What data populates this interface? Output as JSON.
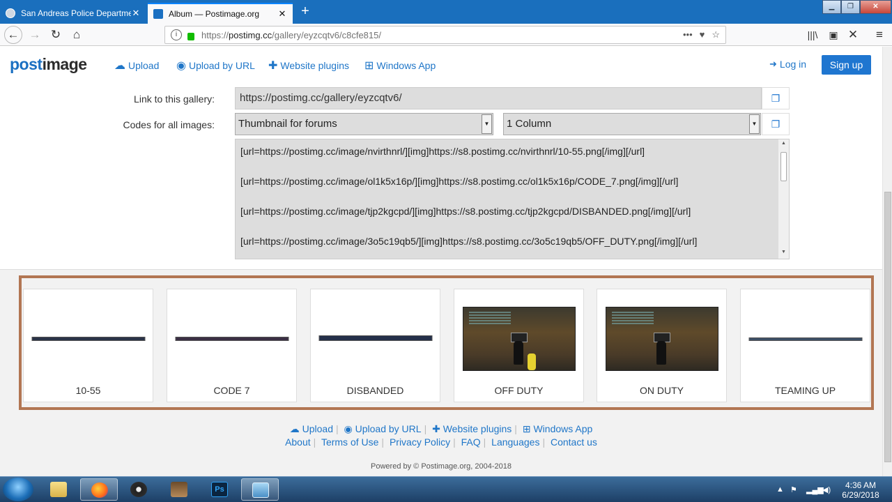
{
  "browser": {
    "tabs": [
      {
        "title": "San Andreas Police Departmen",
        "active": false
      },
      {
        "title": "Album — Postimage.org",
        "active": true
      }
    ],
    "url_prefix": "https://",
    "url_host": "postimg.cc",
    "url_path": "/gallery/eyzcqtv6/c8cfe815/",
    "more_icon": "•••"
  },
  "site": {
    "logo_a": "post",
    "logo_b": "image",
    "menu": {
      "upload": "Upload",
      "upload_url": "Upload by URL",
      "plugins": "Website plugins",
      "windows_app": "Windows App"
    },
    "login": "Log in",
    "signup": "Sign up",
    "accent": "#1f76d0"
  },
  "form": {
    "link_label": "Link to this gallery:",
    "link_value": "https://postimg.cc/gallery/eyzcqtv6/",
    "codes_label": "Codes for all images:",
    "code_type": "Thumbnail for forums",
    "columns": "1 Column",
    "code_lines": [
      "[url=https://postimg.cc/image/nvirthnrl/][img]https://s8.postimg.cc/nvirthnrl/10-55.png[/img][/url]",
      "[url=https://postimg.cc/image/ol1k5x16p/][img]https://s8.postimg.cc/ol1k5x16p/CODE_7.png[/img][/url]",
      "[url=https://postimg.cc/image/tjp2kgcpd/][img]https://s8.postimg.cc/tjp2kgcpd/DISBANDED.png[/img][/url]",
      "[url=https://postimg.cc/image/3o5c19qb5/][img]https://s8.postimg.cc/3o5c19qb5/OFF_DUTY.png[/img][/url]"
    ]
  },
  "gallery": {
    "border_color": "#b27653",
    "items": [
      {
        "caption": "10-55"
      },
      {
        "caption": "CODE 7"
      },
      {
        "caption": "DISBANDED"
      },
      {
        "caption": "OFF DUTY"
      },
      {
        "caption": "ON DUTY"
      },
      {
        "caption": "TEAMING UP"
      }
    ]
  },
  "footer": {
    "upload": "Upload",
    "upload_url": "Upload by URL",
    "plugins": "Website plugins",
    "windows_app": "Windows App",
    "about": "About",
    "terms": "Terms of Use",
    "privacy": "Privacy Policy",
    "faq": "FAQ",
    "languages": "Languages",
    "contact": "Contact us",
    "powered": "Powered by © Postimage.org, 2004-2018"
  },
  "taskbar": {
    "time": "4:36 AM",
    "date": "6/29/2018"
  }
}
